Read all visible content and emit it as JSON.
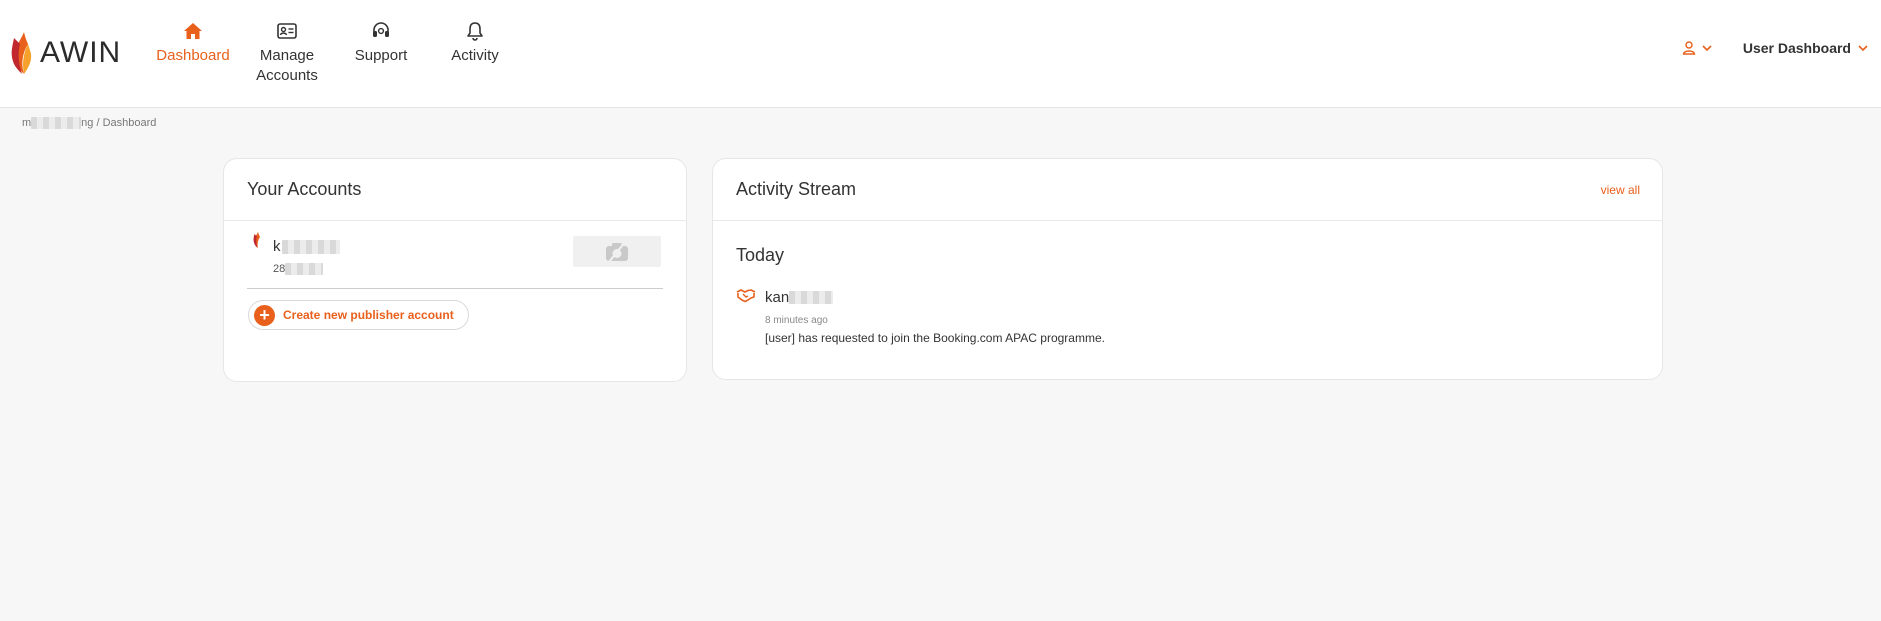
{
  "brand": {
    "name": "AWIN",
    "accent": "#e8601c"
  },
  "nav": [
    {
      "icon": "home-icon",
      "label": "Dashboard",
      "active": true
    },
    {
      "icon": "id-card-icon",
      "label": "Manage Accounts",
      "active": false
    },
    {
      "icon": "headset-icon",
      "label": "Support",
      "active": false
    },
    {
      "icon": "bell-icon",
      "label": "Activity",
      "active": false
    }
  ],
  "header": {
    "dashboard_label": "User Dashboard"
  },
  "breadcrumb": {
    "prefix": "m",
    "suffix": "ng / Dashboard"
  },
  "accounts": {
    "title": "Your Accounts",
    "items": [
      {
        "name_visible": "k",
        "id_visible": "28"
      }
    ],
    "create_label": "Create new publisher account"
  },
  "activity": {
    "title": "Activity Stream",
    "view_all": "view all",
    "day_label": "Today",
    "items": [
      {
        "name_visible": "kan",
        "time": "8 minutes ago",
        "text": "[user] has requested to join the Booking.com APAC programme."
      }
    ]
  }
}
